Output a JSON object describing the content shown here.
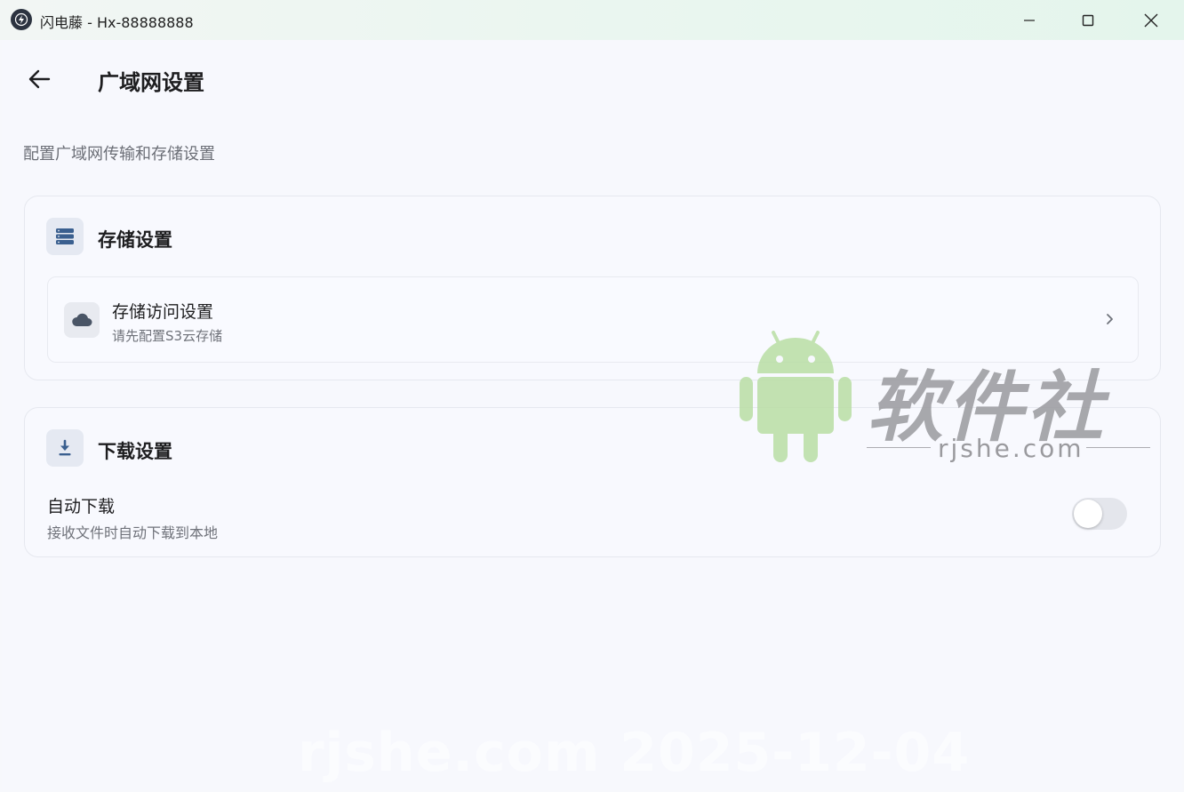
{
  "window": {
    "title": "闪电藤 - Hx-88888888"
  },
  "header": {
    "title": "广域网设置",
    "description": "配置广域网传输和存储设置"
  },
  "storage_section": {
    "title": "存储设置",
    "item": {
      "title": "存储访问设置",
      "subtitle": "请先配置S3云存储"
    }
  },
  "download_section": {
    "title": "下载设置",
    "auto_download": {
      "title": "自动下载",
      "subtitle": "接收文件时自动下载到本地",
      "enabled": false
    }
  },
  "watermark": {
    "brand": "软件社",
    "url": "rjshe.com",
    "stamp": "rjshe.com 2025-12-04"
  },
  "colors": {
    "accent_icon": "#3a5f8f",
    "background": "#f7f8fd",
    "titlebar": "#e9f6ef"
  }
}
